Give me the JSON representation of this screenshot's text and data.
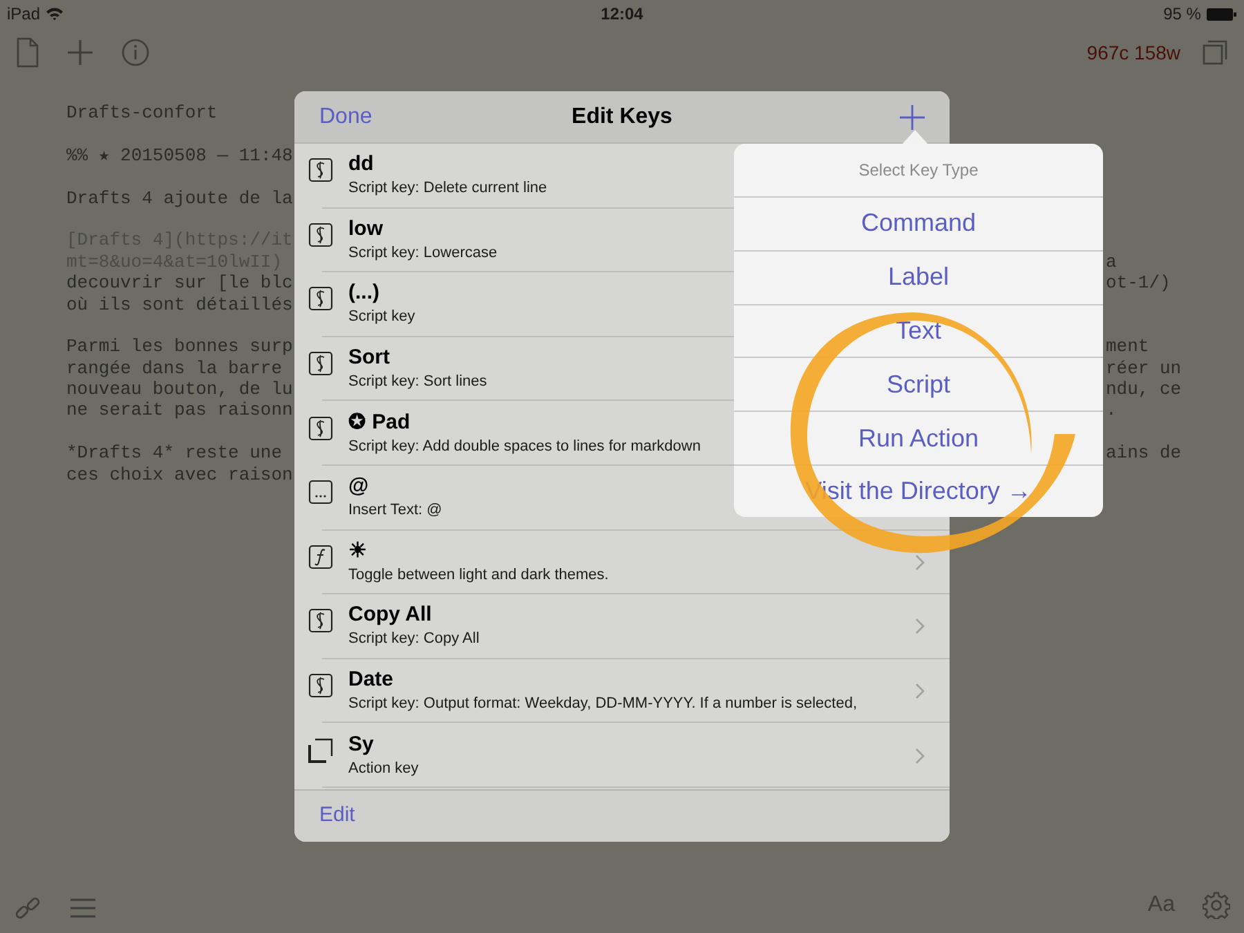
{
  "status_bar": {
    "device": "iPad",
    "time": "12:04",
    "battery": "95 %"
  },
  "toolbar": {
    "counter": "967c 158w"
  },
  "editor": {
    "lines": [
      {
        "kind": "text",
        "left": "Drafts-confort"
      },
      {
        "kind": "blank"
      },
      {
        "kind": "text",
        "left": "%% ★ 20150508 — 11:48"
      },
      {
        "kind": "blank"
      },
      {
        "kind": "text",
        "left": "Drafts 4 ajoute de la"
      },
      {
        "kind": "blank"
      },
      {
        "kind": "url",
        "left": "[Drafts 4](https://it"
      },
      {
        "kind": "url",
        "left": "mt=8&uo=4&at=10lwII)",
        "right": "a"
      },
      {
        "kind": "text",
        "left": "decouvrir sur [le blc",
        "right": "ot-1/)"
      },
      {
        "kind": "text",
        "left": "où ils sont détaillés"
      },
      {
        "kind": "blank"
      },
      {
        "kind": "text",
        "left": "Parmi les bonnes surp",
        "right": "ment"
      },
      {
        "kind": "text",
        "left": "rangée dans la barre",
        "right": "réer un"
      },
      {
        "kind": "text",
        "left": "nouveau bouton, de lu",
        "right": "ndu, ce"
      },
      {
        "kind": "text",
        "left": "ne serait pas raisonn",
        "right": "."
      },
      {
        "kind": "blank"
      },
      {
        "kind": "text",
        "left": "*Drafts 4* reste une",
        "right": "ains de"
      },
      {
        "kind": "text",
        "left": "ces choix avec raison"
      }
    ]
  },
  "modal": {
    "done": "Done",
    "title": "Edit Keys",
    "edit": "Edit",
    "keys": [
      {
        "kind": "script",
        "title": "dd",
        "subtitle": "Script key: Delete current line"
      },
      {
        "kind": "script",
        "title": "low",
        "subtitle": "Script key: Lowercase"
      },
      {
        "kind": "script",
        "title": "(...)",
        "subtitle": "Script key"
      },
      {
        "kind": "script",
        "title": "Sort",
        "subtitle": "Script key: Sort lines"
      },
      {
        "kind": "script",
        "title": "✪ Pad",
        "subtitle": "Script key: Add double spaces to lines for markdown"
      },
      {
        "kind": "text",
        "title": "@",
        "subtitle": "Insert Text: @"
      },
      {
        "kind": "function",
        "title": "☀",
        "subtitle": "Toggle between light and dark themes."
      },
      {
        "kind": "script",
        "title": "Copy All",
        "subtitle": "Script key: Copy All"
      },
      {
        "kind": "script",
        "title": "Date",
        "subtitle": "Script key: Output format: Weekday, DD-MM-YYYY. If a number is selected,"
      },
      {
        "kind": "action",
        "title": "Sy",
        "subtitle": "Action key"
      }
    ]
  },
  "popover": {
    "title": "Select Key Type",
    "options": [
      "Command",
      "Label",
      "Text",
      "Script",
      "Run Action",
      "Visit the Directory →"
    ]
  },
  "bottom_bar": {
    "font_button": "Aa"
  }
}
